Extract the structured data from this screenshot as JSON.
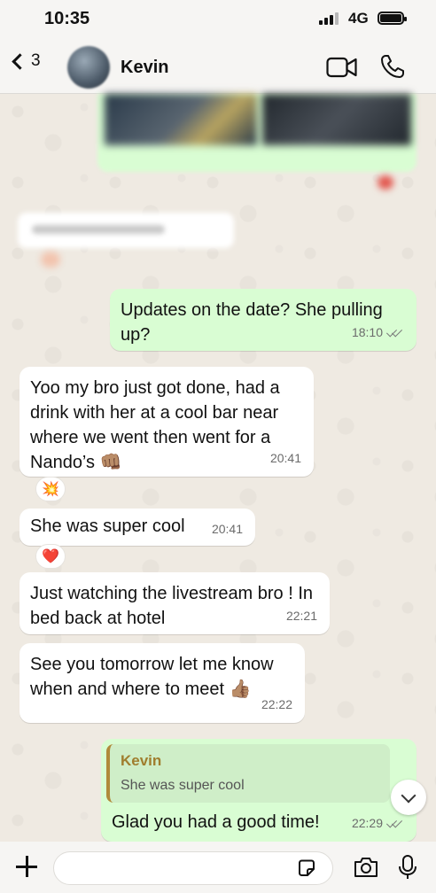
{
  "status_bar": {
    "time": "10:35",
    "network": "4G"
  },
  "header": {
    "back_count": "3",
    "contact_name": "Kevin"
  },
  "messages": [
    {
      "text": "Updates on the date? She pulling up?",
      "time": "18:10"
    },
    {
      "text": "Yoo my bro just got done, had a drink with her at a cool bar near where we went then went for a Nando’s 👊🏽",
      "time": "20:41",
      "reaction": "💥"
    },
    {
      "text": "She was super cool",
      "time": "20:41",
      "reaction": "❤️"
    },
    {
      "text": "Just watching the livestream bro ! In bed back at hotel",
      "time": "22:21"
    },
    {
      "text": "See you tomorrow let me know when and where to meet 👍🏽",
      "time": "22:22"
    },
    {
      "quote_name": "Kevin",
      "quote_text": "She was super cool",
      "text": "Glad you had a good time!",
      "time": "22:29"
    }
  ],
  "input": {
    "placeholder": ""
  },
  "colors": {
    "outgoing": "#d9fdd3",
    "incoming": "#ffffff",
    "background": "#efeae2",
    "quote_accent": "#b08a3a"
  }
}
